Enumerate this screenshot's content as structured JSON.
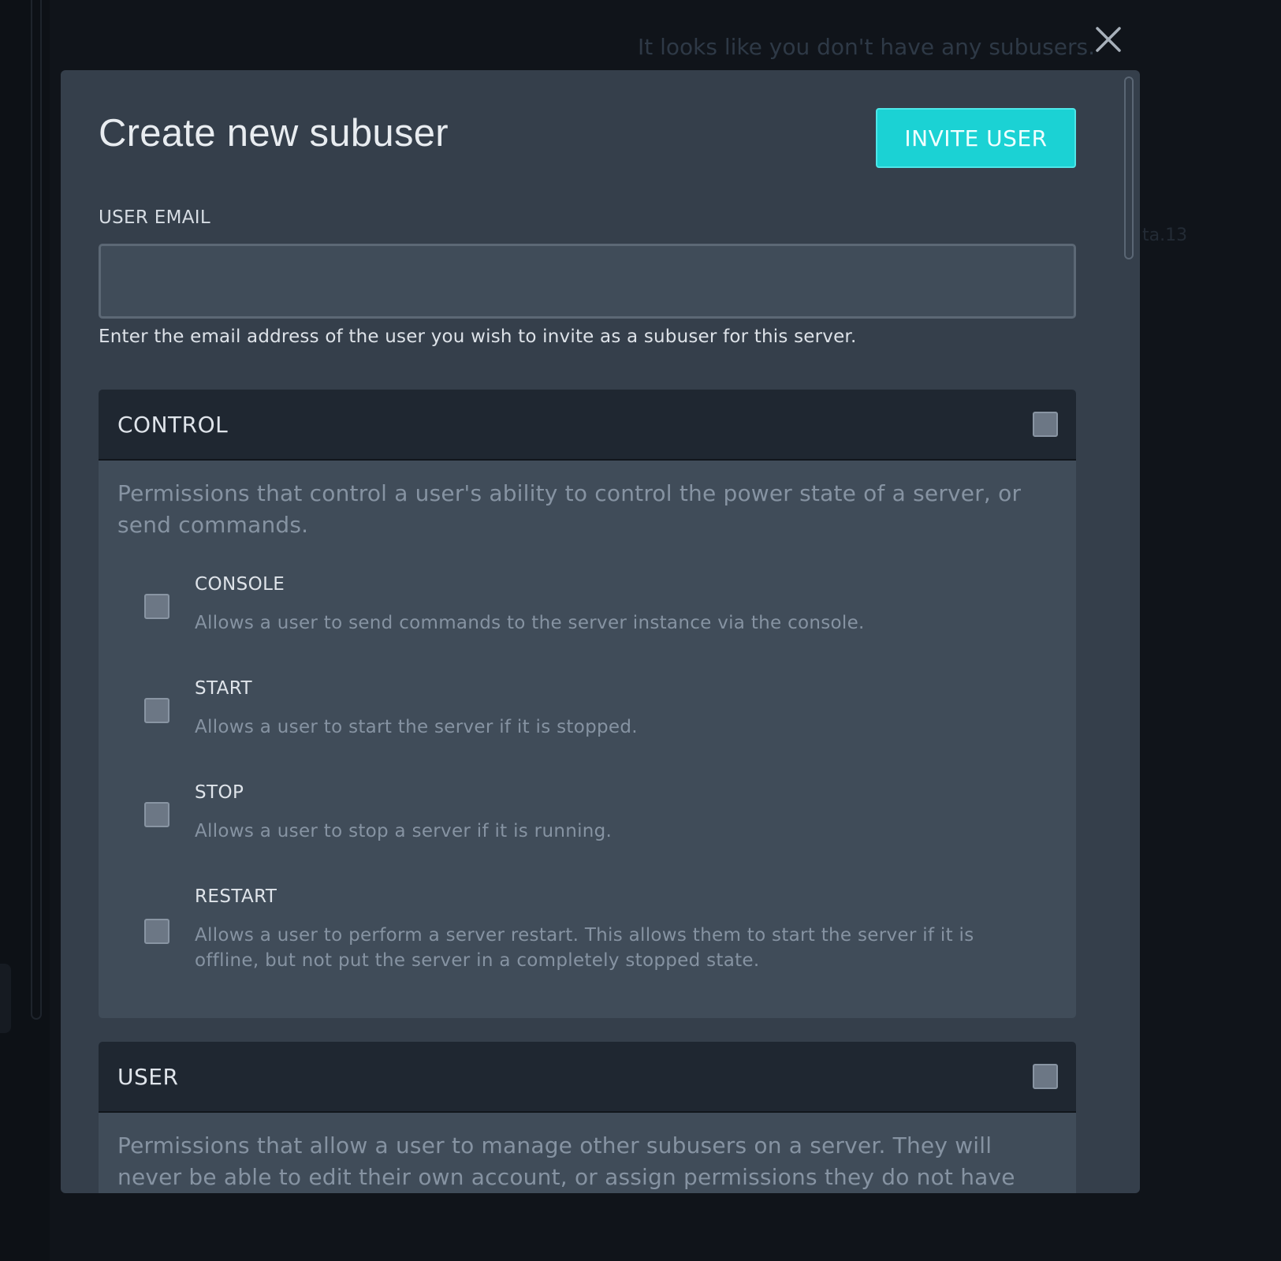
{
  "background": {
    "empty_message": "It looks like you don't have any subusers.",
    "partial_text": "ta.13"
  },
  "modal": {
    "title": "Create new subuser",
    "invite_button": "INVITE USER",
    "email": {
      "label": "USER EMAIL",
      "value": "",
      "help": "Enter the email address of the user you wish to invite as a subuser for this server."
    },
    "groups": [
      {
        "title": "CONTROL",
        "checked": false,
        "description": "Permissions that control a user's ability to control the power state of a server, or send commands.",
        "permissions": [
          {
            "name": "CONSOLE",
            "description": "Allows a user to send commands to the server instance via the console.",
            "checked": false
          },
          {
            "name": "START",
            "description": "Allows a user to start the server if it is stopped.",
            "checked": false
          },
          {
            "name": "STOP",
            "description": "Allows a user to stop a server if it is running.",
            "checked": false
          },
          {
            "name": "RESTART",
            "description": "Allows a user to perform a server restart. This allows them to start the server if it is offline, but not put the server in a completely stopped state.",
            "checked": false
          }
        ]
      },
      {
        "title": "USER",
        "checked": false,
        "description": "Permissions that allow a user to manage other subusers on a server. They will never be able to edit their own account, or assign permissions they do not have"
      }
    ]
  },
  "colors": {
    "page_background": "#10141a",
    "modal_background": "#353f4b",
    "accent": "#1bd2d4",
    "group_header": "#1f2731",
    "muted_text": "#8693a2"
  },
  "icons": {
    "close": "close-icon"
  }
}
